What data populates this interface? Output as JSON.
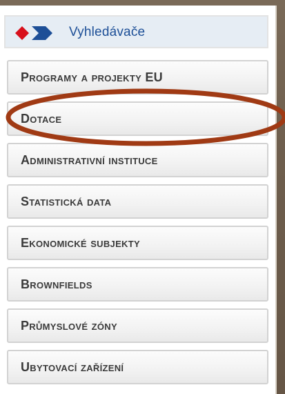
{
  "header": {
    "title": "Vyhledávače",
    "logo_icon": "arrow-diamond-logo-icon",
    "logo_colors": [
      "#d8101c",
      "#1d4f97"
    ]
  },
  "menu": {
    "items": [
      {
        "label": "Programy a projekty EU"
      },
      {
        "label": "Dotace",
        "highlighted": true
      },
      {
        "label": "Administrativní instituce"
      },
      {
        "label": "Statistická data"
      },
      {
        "label": "Ekonomické subjekty"
      },
      {
        "label": "Brownfields"
      },
      {
        "label": "Průmyslové zóny"
      },
      {
        "label": "Ubytovací zařízení"
      }
    ]
  },
  "highlight": {
    "color": "#a03a14",
    "target": "Dotace"
  }
}
